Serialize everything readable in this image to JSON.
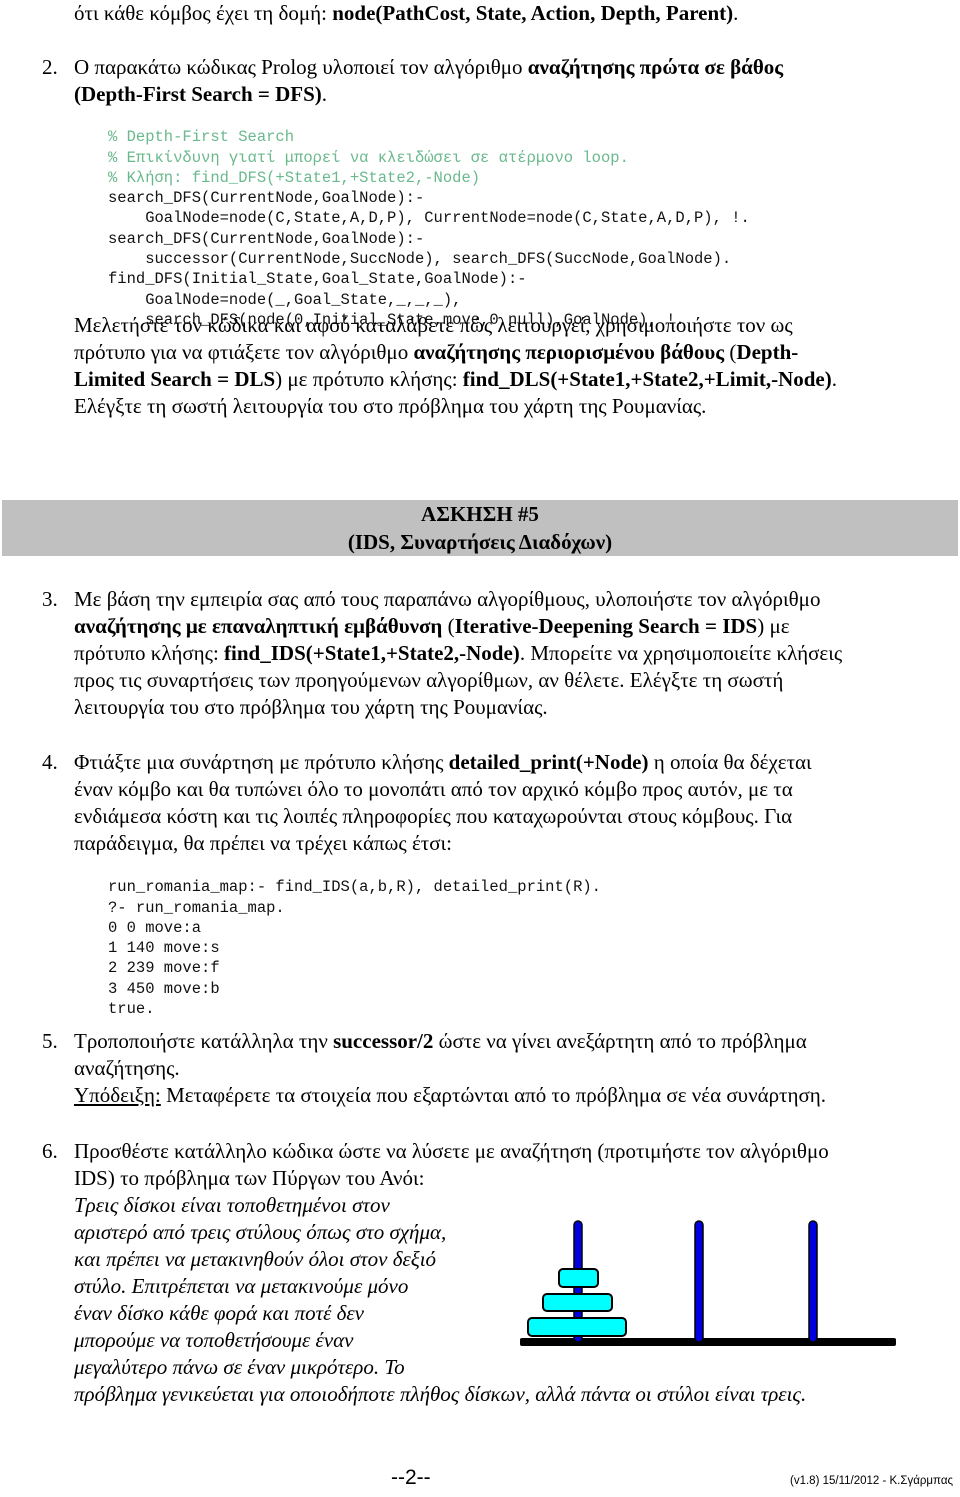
{
  "intro_line": {
    "prefix": "ότι κάθε κόμβος έχει τη δομή: ",
    "bold": "node(PathCost, State, Action, Depth, Parent)",
    "suffix": "."
  },
  "item2": {
    "number": "2.",
    "line1_prefix": "Ο παρακάτω κώδικας Prolog υλοποιεί τον αλγόριθμο ",
    "line1_bold": "αναζήτησης πρώτα σε βάθος",
    "line2_bold": "(Depth-First Search = DFS)",
    "line2_suffix": ".",
    "code_comments": [
      "% Depth-First Search",
      "% Επικίνδυνη γιατί μπορεί να κλειδώσει σε ατέρμονο loop.",
      "% Κλήση: find_DFS(+State1,+State2,-Node)"
    ],
    "code_lines": [
      "search_DFS(CurrentNode,GoalNode):-",
      "    GoalNode=node(C,State,A,D,P), CurrentNode=node(C,State,A,D,P), !.",
      "search_DFS(CurrentNode,GoalNode):-",
      "    successor(CurrentNode,SuccNode), search_DFS(SuccNode,GoalNode).",
      "find_DFS(Initial_State,Goal_State,GoalNode):-",
      "    GoalNode=node(_,Goal_State,_,_,_),",
      "    search_DFS(node(0,Initial_State,move,0,null),GoalNode), !."
    ],
    "para_l1": "Μελετήστε τον κώδικα και αφού καταλάβετε πώς λειτουργεί, χρησιμοποιήστε τον ως",
    "para_l2_prefix": "πρότυπο για να φτιάξετε τον αλγόριθμο ",
    "para_l2_bold1": "αναζήτησης περιορισμένου βάθους",
    "para_l2_mid": " (",
    "para_l2_bold2": "Depth-",
    "para_l3_bold1": "Limited Search = DLS",
    "para_l3_mid": ") με πρότυπο κλήσης: ",
    "para_l3_bold2": "find_DLS(+State1,+State2,+Limit,-Node)",
    "para_l3_suffix": ".",
    "para_l4": "Ελέγξτε τη σωστή λειτουργία του στο πρόβλημα του χάρτη της Ρουμανίας."
  },
  "banner": {
    "title": "ΑΣΚΗΣΗ #5",
    "subtitle": "(IDS, Συναρτήσεις Διαδόχων)",
    "background": "#c0c0c0"
  },
  "item3": {
    "number": "3.",
    "l1": "Με βάση την εμπειρία σας από τους παραπάνω αλγορίθμους, υλοποιήστε τον αλγόριθμο",
    "l2_bold1": "αναζήτησης με επαναληπτική εμβάθυνση",
    "l2_mid": " (",
    "l2_bold2": "Iterative-Deepening Search = IDS",
    "l2_suffix": ") με",
    "l3_prefix": "πρότυπο κλήσης: ",
    "l3_bold": "find_IDS(+State1,+State2,-Node)",
    "l3_suffix": ". Μπορείτε να χρησιμοποιείτε κλήσεις",
    "l4": "προς τις συναρτήσεις των προηγούμενων αλγορίθμων, αν θέλετε. Ελέγξτε τη σωστή",
    "l5": "λειτουργία του στο πρόβλημα του χάρτη της Ρουμανίας."
  },
  "item4": {
    "number": "4.",
    "l1_prefix": "Φτιάξτε μια συνάρτηση με πρότυπο κλήσης ",
    "l1_bold": "detailed_print(+Node)",
    "l1_suffix": " η οποία θα δέχεται",
    "l2": "έναν κόμβο και θα τυπώνει όλο το μονοπάτι από τον αρχικό κόμβο προς αυτόν, με τα",
    "l3": "ενδιάμεσα κόστη και τις λοιπές πληροφορίες που καταχωρούνται στους κόμβους. Για",
    "l4": "παράδειγμα, θα πρέπει να τρέχει κάπως έτσι:",
    "code_lines": [
      "run_romania_map:- find_IDS(a,b,R), detailed_print(R).",
      "?- run_romania_map.",
      "0 0 move:a",
      "1 140 move:s",
      "2 239 move:f",
      "3 450 move:b",
      "true."
    ]
  },
  "item5": {
    "number": "5.",
    "l1_prefix": "Τροποποιήστε κατάλληλα την ",
    "l1_bold": "successor/2",
    "l1_suffix": " ώστε να γίνει ανεξάρτητη από το πρόβλημα",
    "l2": "αναζήτησης.",
    "hint_label": "Υπόδειξη:",
    "hint_text": " Μεταφέρετε τα στοιχεία που εξαρτώνται από το πρόβλημα σε νέα συνάρτηση."
  },
  "item6": {
    "number": "6.",
    "l1": "Προσθέστε κατάλληλο κώδικα ώστε να λύσετε με αναζήτηση (προτιμήστε τον αλγόριθμο",
    "l2": "IDS) το πρόβλημα των Πύργων του Ανόι:",
    "italic_lines": [
      "Τρεις δίσκοι είναι τοποθετημένοι στον",
      "αριστερό από τρεις στύλους όπως στο σχήμα,",
      "και πρέπει να μετακινηθούν όλοι στον δεξιό",
      "στύλο. Επιτρέπεται να μετακινούμε μόνο",
      "έναν δίσκο κάθε φορά και ποτέ δεν",
      "μπορούμε να τοποθετήσουμε έναν",
      "μεγαλύτερο πάνω σε έναν μικρότερο. Το",
      "πρόβλημα γενικεύεται για οποιοδήποτε πλήθος δίσκων, αλλά πάντα οι στύλοι είναι τρεις."
    ],
    "hanoi": {
      "pegs": 3,
      "disks_on_left_peg": 3,
      "peg_color": "#0000e0",
      "disk_color": "#00ffff",
      "base_color": "#000000"
    }
  },
  "footer": {
    "page": "--2--",
    "version": "(v1.8) 15/11/2012 - Κ.Σγάρμπας"
  }
}
